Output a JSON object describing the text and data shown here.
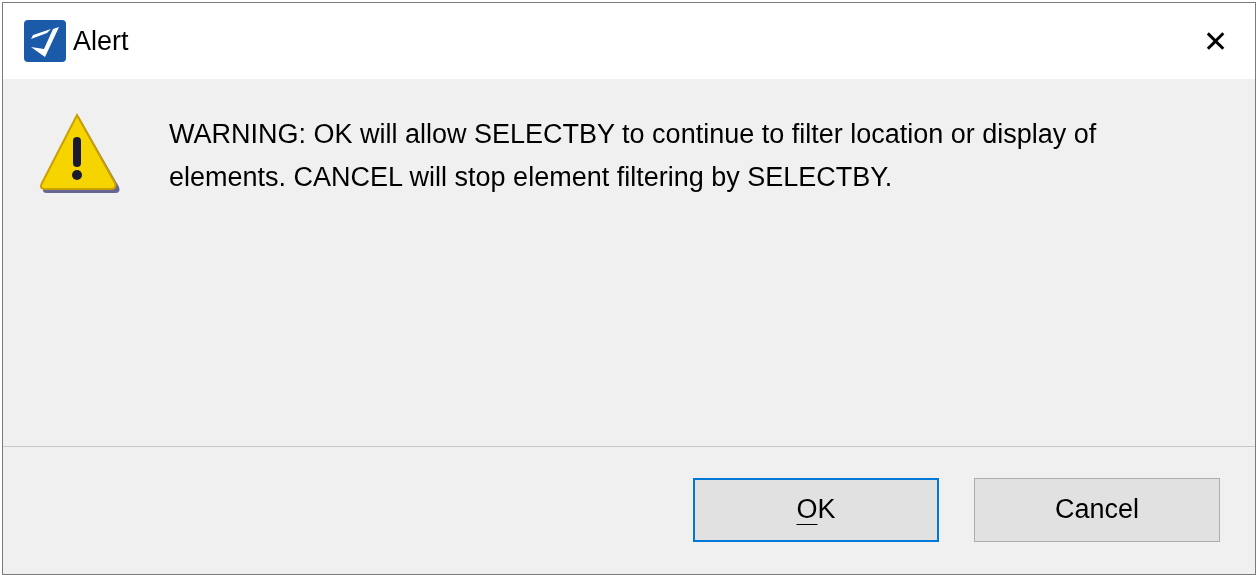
{
  "window": {
    "title": "Alert",
    "close": "✕"
  },
  "message": "WARNING: OK will allow SELECTBY to continue to filter location or display of elements. CANCEL will stop element filtering by SELECTBY.",
  "buttons": [
    {
      "label": "OK",
      "focused": true,
      "mnemonic": true
    },
    {
      "label": "Cancel",
      "focused": false,
      "mnemonic": false
    }
  ]
}
